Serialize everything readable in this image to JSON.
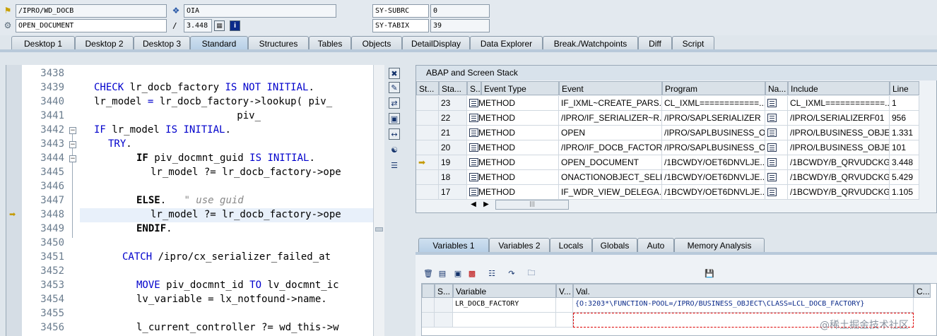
{
  "top": {
    "program_field": "/IPRO/WD_DOCB",
    "event_field": "OPEN_DOCUMENT",
    "object_field": "OIA",
    "slash": "/",
    "line_field": "3.448",
    "sy_subrc_label": "SY-SUBRC",
    "sy_subrc_value": "0",
    "sy_tabix_label": "SY-TABIX",
    "sy_tabix_value": "39",
    "info_icon": "i"
  },
  "tabs": [
    "Desktop 1",
    "Desktop 2",
    "Desktop 3",
    "Standard",
    "Structures",
    "Tables",
    "Objects",
    "DetailDisplay",
    "Data Explorer",
    "Break./Watchpoints",
    "Diff",
    "Script"
  ],
  "active_tab": "Standard",
  "code": {
    "lines": [
      {
        "num": "3438",
        "text": ""
      },
      {
        "num": "3439",
        "text": ""
      },
      {
        "num": "3440",
        "text": ""
      },
      {
        "num": "3441",
        "text": ""
      },
      {
        "num": "3442",
        "text": ""
      },
      {
        "num": "3443",
        "text": ""
      },
      {
        "num": "3444",
        "text": ""
      },
      {
        "num": "3445",
        "text": ""
      },
      {
        "num": "3446",
        "text": ""
      },
      {
        "num": "3447",
        "text": ""
      },
      {
        "num": "3448",
        "text": ""
      },
      {
        "num": "3449",
        "text": ""
      },
      {
        "num": "3450",
        "text": ""
      },
      {
        "num": "3451",
        "text": ""
      },
      {
        "num": "3452",
        "text": ""
      },
      {
        "num": "3453",
        "text": ""
      },
      {
        "num": "3454",
        "text": ""
      },
      {
        "num": "3455",
        "text": ""
      },
      {
        "num": "3456",
        "text": ""
      }
    ],
    "tokens": {
      "l3439_kw1": "CHECK",
      "l3439_a": " lr_docb_factory ",
      "l3439_kw2": "IS NOT INITIAL",
      "l3439_b": ".",
      "l3440_a": "lr_model ",
      "l3440_kw": "=",
      "l3440_b": " lr_docb_factory->lookup( piv_",
      "l3441_a": "                        piv_",
      "l3442_kw": "IF",
      "l3442_a": " lr_model ",
      "l3442_kw2": "IS INITIAL",
      "l3442_b": ".",
      "l3443_kw": "TRY",
      "l3443_b": ".",
      "l3444_kw": "IF",
      "l3444_a": " piv_docmnt_guid ",
      "l3444_kw2": "IS INITIAL",
      "l3444_b": ".",
      "l3445_a": "lr_model ?= lr_docb_factory->ope",
      "l3447_kw": "ELSE",
      "l3447_b": ".",
      "l3447_cm": "\" use guid",
      "l3448_a": "lr_model ?= lr_docb_factory->ope",
      "l3449_kw": "ENDIF",
      "l3449_b": ".",
      "l3451_kw": "CATCH",
      "l3451_a": " /ipro/cx_serializer_failed_at",
      "l3453_kw": "MOVE",
      "l3453_a": " piv_docmnt_id ",
      "l3453_kw2": "TO",
      "l3453_b": " lv_docmnt_ic",
      "l3454_a": "lv_variable = lx_notfound->name.",
      "l3456_a": "l_current_controller ?= wd_this->w"
    }
  },
  "stack": {
    "title": "ABAP and Screen Stack",
    "columns": [
      "St...",
      "Sta...",
      "S...",
      "Event Type",
      "Event",
      "Program",
      "Na...",
      "Include",
      "Line"
    ],
    "rows": [
      {
        "level": "23",
        "type": "METHOD",
        "event": "IF_IXML~CREATE_PARS...",
        "program": "CL_IXML============...",
        "include": "CL_IXML============...",
        "line": "1",
        "current": false
      },
      {
        "level": "22",
        "type": "METHOD",
        "event": "/IPRO/IF_SERIALIZER~R...",
        "program": "/IPRO/SAPLSERIALIZER",
        "include": "/IPRO/LSERIALIZERF01",
        "line": "956",
        "current": false
      },
      {
        "level": "21",
        "type": "METHOD",
        "event": "OPEN",
        "program": "/IPRO/SAPLBUSINESS_O...",
        "include": "/IPRO/LBUSINESS_OBJE...",
        "line": "1.331",
        "current": false
      },
      {
        "level": "20",
        "type": "METHOD",
        "event": "/IPRO/IF_DOCB_FACTOR...",
        "program": "/IPRO/SAPLBUSINESS_O...",
        "include": "/IPRO/LBUSINESS_OBJE...",
        "line": "101",
        "current": false
      },
      {
        "level": "19",
        "type": "METHOD",
        "event": "OPEN_DOCUMENT",
        "program": "/1BCWDY/OET6DNVLJE...",
        "include": "/1BCWDY/B_QRVUDCKG...",
        "line": "3.448",
        "current": true
      },
      {
        "level": "18",
        "type": "METHOD",
        "event": "ONACTIONOBJECT_SELE...",
        "program": "/1BCWDY/OET6DNVLJE...",
        "include": "/1BCWDY/B_QRVUDCKG...",
        "line": "5.429",
        "current": false
      },
      {
        "level": "17",
        "type": "METHOD",
        "event": "IF_WDR_VIEW_DELEGA...",
        "program": "/1BCWDY/OET6DNVLJE...",
        "include": "/1BCWDY/B_QRVUDCKG...",
        "line": "1.105",
        "current": false
      }
    ]
  },
  "variables": {
    "tabs": [
      "Variables 1",
      "Variables 2",
      "Locals",
      "Globals",
      "Auto",
      "Memory Analysis"
    ],
    "active_tab": "Variables 1",
    "columns": [
      "S...",
      "Variable",
      "V...",
      "Val.",
      "C..."
    ],
    "rows": [
      {
        "variable": "LR_DOCB_FACTORY",
        "value": "{O:3203*\\FUNCTION-POOL=/IPRO/BUSINESS_OBJECT\\CLASS=LCL_DOCB_FACTORY}"
      },
      {
        "variable": "",
        "value": ""
      }
    ]
  },
  "watermark": "@稀土掘金技术社区",
  "colors": {
    "keyword": "#0000cc",
    "comment": "#888888",
    "current_line": "#e8f0fa",
    "arrow": "#c49a00"
  }
}
